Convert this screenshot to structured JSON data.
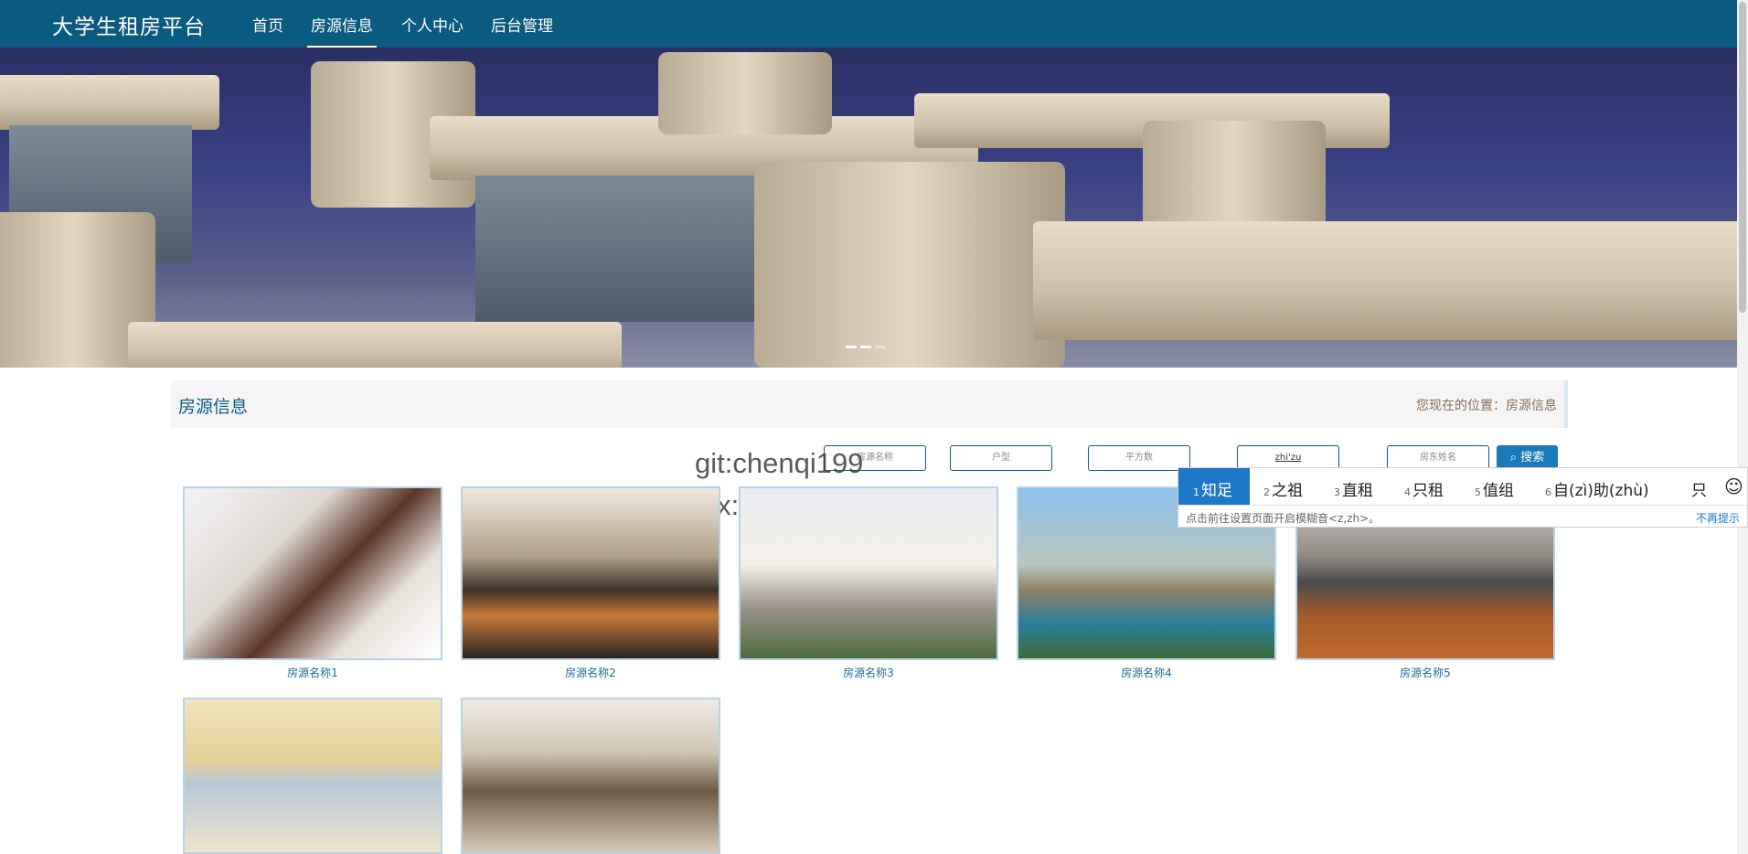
{
  "nav": {
    "brand": "大学生租房平台",
    "items": [
      {
        "label": "首页"
      },
      {
        "label": "房源信息"
      },
      {
        "label": "个人中心"
      },
      {
        "label": "后台管理"
      }
    ]
  },
  "section": {
    "title": "房源信息",
    "breadcrumb": "您现在的位置：房源信息"
  },
  "search": {
    "fields": [
      "房源名称",
      "户型",
      "平方数",
      "zhi'zu",
      "房东姓名"
    ],
    "button_label": "搜索"
  },
  "watermark": {
    "line1": "git:chenqi199",
    "line2": "v x:chen_q123456"
  },
  "ime": {
    "candidates": [
      {
        "n": "1",
        "text": "知足"
      },
      {
        "n": "2",
        "text": "之祖"
      },
      {
        "n": "3",
        "text": "直租"
      },
      {
        "n": "4",
        "text": "只租"
      },
      {
        "n": "5",
        "text": "值组"
      },
      {
        "n": "6",
        "text": "自(zì)助(zhù)"
      }
    ],
    "extra_char": "只",
    "hint": "点击前往设置页面开启模糊音<z,zh>。",
    "dismiss": "不再提示"
  },
  "listings": [
    {
      "name": "房源名称1"
    },
    {
      "name": "房源名称2"
    },
    {
      "name": "房源名称3"
    },
    {
      "name": "房源名称4"
    },
    {
      "name": "房源名称5"
    },
    {
      "name": "",
      "image": "living-room-gold"
    },
    {
      "name": "",
      "image": "living-room-brown"
    }
  ],
  "colors": {
    "navbar": "#0b5a80",
    "accent": "#1a7ab8",
    "ime_selected": "#1e78c8"
  }
}
